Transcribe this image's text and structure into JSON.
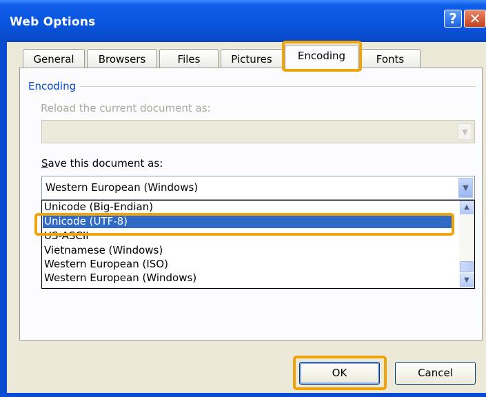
{
  "window": {
    "title": "Web Options",
    "help_glyph": "?",
    "close_glyph": "✕"
  },
  "tabs": [
    {
      "label": "General"
    },
    {
      "label": "Browsers"
    },
    {
      "label": "Files"
    },
    {
      "label": "Pictures"
    },
    {
      "label": "Encoding",
      "active": true
    },
    {
      "label": "Fonts"
    }
  ],
  "encoding": {
    "group_label": "Encoding",
    "reload_label": "Reload the current document as:",
    "reload_value": "",
    "save_label": "Save this document as:",
    "save_value": "Western European (Windows)",
    "options": [
      "Unicode (Big-Endian)",
      "Unicode (UTF-8)",
      "US-ASCII",
      "Vietnamese (Windows)",
      "Western European (ISO)",
      "Western European (Windows)"
    ],
    "selected_option": "Unicode (UTF-8)"
  },
  "buttons": {
    "ok": "OK",
    "cancel": "Cancel"
  },
  "colors": {
    "highlight": "#f0a30a",
    "selection": "#316ac5",
    "titlebar": "#0a55df"
  },
  "icons": {
    "dropdown": "chevron-down-icon",
    "scroll_up": "chevron-up-icon",
    "scroll_down": "chevron-down-icon"
  }
}
